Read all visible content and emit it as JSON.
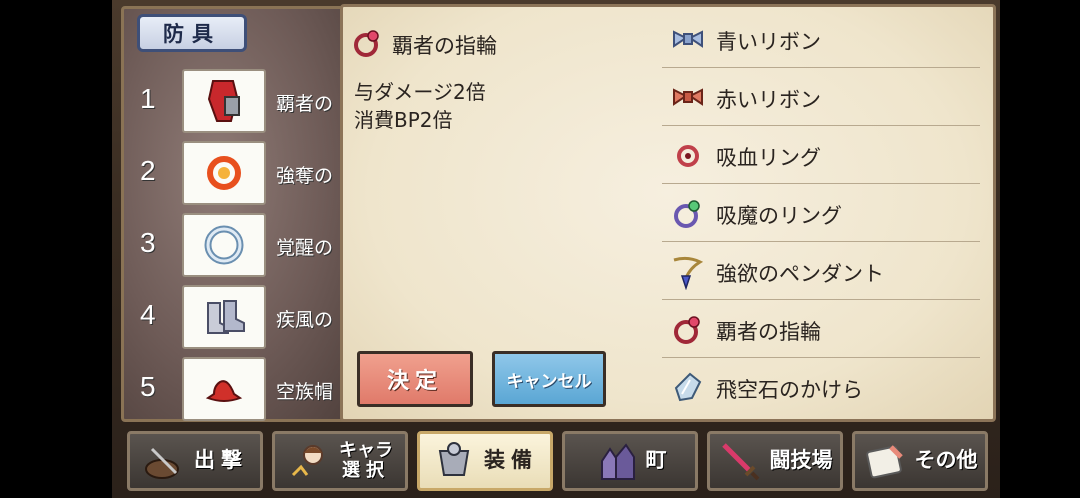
{
  "category": {
    "title": "防具"
  },
  "equipment_slots": [
    {
      "number": "1",
      "label": "覇者の",
      "icon": "armor-red-cape-icon"
    },
    {
      "number": "2",
      "label": "強奪の",
      "icon": "fire-ring-icon"
    },
    {
      "number": "3",
      "label": "覚醒の",
      "icon": "silver-ring-icon"
    },
    {
      "number": "4",
      "label": "疾風の",
      "icon": "wind-boots-icon"
    },
    {
      "number": "5",
      "label": "空族帽",
      "icon": "red-hat-icon"
    }
  ],
  "detail": {
    "name": "覇者の指輪",
    "icon": "ruby-ring-icon",
    "effects": [
      "与ダメージ2倍",
      "消費BP2倍"
    ]
  },
  "buttons": {
    "confirm": "決定",
    "cancel": "キャンセル"
  },
  "items": [
    {
      "label": "青いリボン",
      "icon": "blue-ribbon-icon"
    },
    {
      "label": "赤いリボン",
      "icon": "red-ribbon-icon"
    },
    {
      "label": "吸血リング",
      "icon": "blood-ring-icon"
    },
    {
      "label": "吸魔のリング",
      "icon": "mana-ring-icon"
    },
    {
      "label": "強欲のペンダント",
      "icon": "pendant-icon"
    },
    {
      "label": "覇者の指輪",
      "icon": "ruby-ring-icon"
    },
    {
      "label": "飛空石のかけら",
      "icon": "crystal-shard-icon"
    }
  ],
  "nav": [
    {
      "label": "出撃",
      "icon": "sortie-icon",
      "active": false
    },
    {
      "label": "キャラ\n選択",
      "icon": "character-select-icon",
      "active": false
    },
    {
      "label": "装備",
      "icon": "equipment-icon",
      "active": true
    },
    {
      "label": "町",
      "icon": "town-icon",
      "active": false
    },
    {
      "label": "闘技場",
      "icon": "sword-icon",
      "active": false
    },
    {
      "label": "その他",
      "icon": "scroll-icon",
      "active": false
    }
  ],
  "colors": {
    "confirm": "#e07a6a",
    "cancel": "#5aa6d4",
    "parchment": "#f3ead5"
  }
}
